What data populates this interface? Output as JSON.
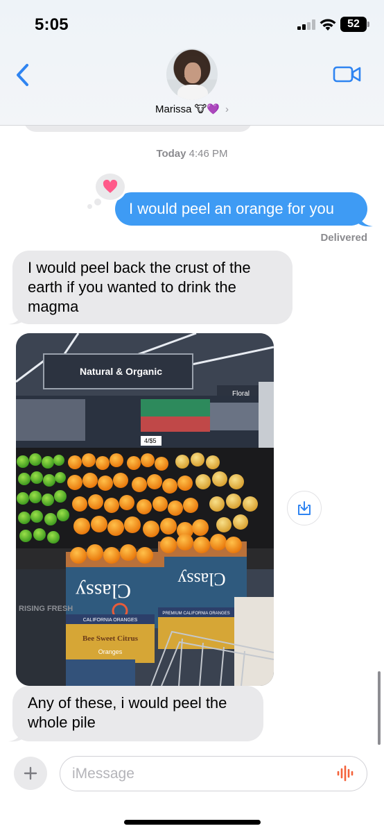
{
  "status_bar": {
    "time": "5:05",
    "battery": "52"
  },
  "header": {
    "contact_name": "Marissa",
    "contact_emojis": "🐮💜",
    "chevron": "›",
    "back_icon": "chevron-left-icon",
    "video_icon": "video-camera-icon"
  },
  "thread": {
    "timestamp_day": "Today",
    "timestamp_time": "4:46 PM",
    "messages": [
      {
        "direction": "outgoing",
        "text": "I would peel an orange for you",
        "reaction": "heart"
      },
      {
        "direction": "incoming",
        "text": "I would peel back the crust of the earth if you wanted to drink the magma"
      },
      {
        "direction": "incoming",
        "type": "photo"
      },
      {
        "direction": "incoming",
        "text": "Any of these, i would peel the whole pile"
      }
    ],
    "delivered_label": "Delivered"
  },
  "photo": {
    "sign_text": "Natural & Organic",
    "sign_text_2": "Floral",
    "price_tag": "4/$5",
    "box_brand": "Classy",
    "box_label_1": "PREMIUM CALIFORNIA ORANGES",
    "box_label_2": "CALIFORNIA ORANGES",
    "crate_brand": "Bee Sweet Citrus",
    "crate_sub": "Oranges",
    "bin_text": "RISING FRESH"
  },
  "composer": {
    "placeholder": "iMessage"
  },
  "colors": {
    "accent": "#3e9bf4",
    "incoming_bubble": "#e9e9eb",
    "tapback_heart": "#ff5a8a",
    "mic": "#f4623a"
  }
}
